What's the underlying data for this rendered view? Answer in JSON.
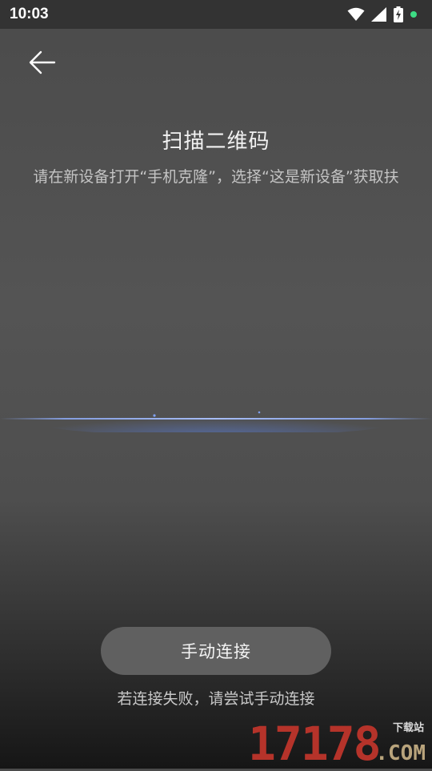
{
  "status_bar": {
    "time": "10:03",
    "icons": [
      "wifi-icon",
      "cellular-signal-icon",
      "battery-charging-icon",
      "notification-dot-icon"
    ],
    "dot_color": "#3ddc84"
  },
  "header": {
    "back_icon": "arrow-left-icon",
    "title": "扫描二维码",
    "subtitle": "请在新设备打开“手机克隆”，选择“这是新设备”获取扶占二维码"
  },
  "scanner": {
    "line_color": "#6f8fe0"
  },
  "actions": {
    "manual_connect_label": "手动连接",
    "hint": "若连接失败，请尝试手动连接"
  },
  "watermark": {
    "number": "17178",
    "site": "下载站",
    "com": ".COM"
  },
  "colors": {
    "status_bar": "#333333",
    "background": "#505050",
    "button": "#606060",
    "watermark_red": "#b5332a",
    "watermark_tan": "#b9a47c"
  }
}
